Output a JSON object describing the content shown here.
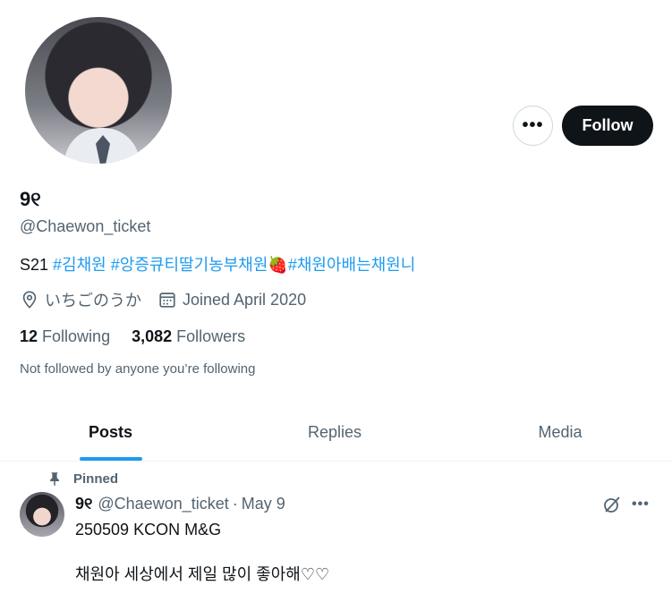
{
  "profile": {
    "display_name": "9୧",
    "handle": "@Chaewon_ticket",
    "bio_prefix": "S21",
    "bio_tags": [
      "#김채원",
      "#앙증큐티딸기농부채원",
      "#채원아배는채원니"
    ],
    "bio_emoji": "🍓",
    "location": "いちごのうか",
    "joined": "Joined April 2020",
    "following_count": "12",
    "following_label": "Following",
    "followers_count": "3,082",
    "followers_label": "Followers",
    "not_followed": "Not followed by anyone you’re following"
  },
  "actions": {
    "more_label": "•••",
    "follow_label": "Follow"
  },
  "tabs": [
    {
      "label": "Posts",
      "active": true
    },
    {
      "label": "Replies",
      "active": false
    },
    {
      "label": "Media",
      "active": false
    }
  ],
  "post": {
    "pinned_label": "Pinned",
    "author_name": "9୧",
    "author_handle": "@Chaewon_ticket",
    "separator": "·",
    "date": "May 9",
    "more_label": "•••",
    "line1": "250509 KCON M&G",
    "line2": "채원아 세상에서 제일 많이 좋아해♡♡"
  },
  "icons": [
    "location-icon",
    "calendar-icon",
    "pin-icon",
    "grok-icon",
    "more-icon"
  ],
  "colors": {
    "accent": "#1d9bf0",
    "text_primary": "#0f1419",
    "text_secondary": "#536471",
    "follow_button_bg": "#0f1419"
  }
}
